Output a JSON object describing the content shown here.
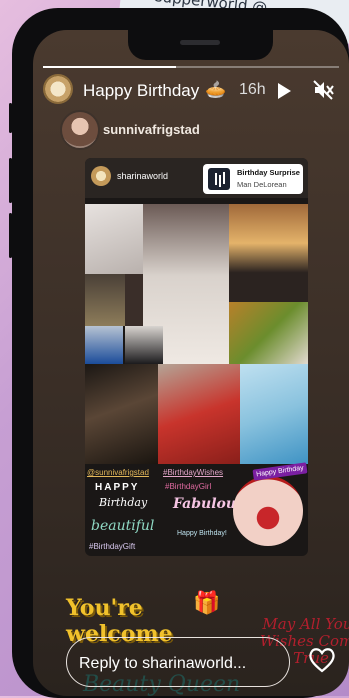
{
  "background_paper": {
    "text": "supperworld @..."
  },
  "story": {
    "header": {
      "title": "Happy Birthday",
      "emoji": "🥧",
      "time": "16h",
      "play_icon": "play-icon",
      "mute_icon": "volume-muted-icon"
    },
    "mention_user": "sunnivafrigstad",
    "reshared_post": {
      "username": "sharinaworld",
      "music": {
        "title": "Birthday Surprise",
        "artist": "Man DeLorean"
      },
      "collage_labels": {
        "tag": "@sunnivafrigstad",
        "hashtag1": "#BirthdayWishes",
        "hashtag2": "#BirthdayGirl",
        "hashtag3": "#BirthdayGift",
        "happy": "HAPPY",
        "birthday": "Birthday",
        "beautiful": "beautiful",
        "fabulous": "Fabulous",
        "happy_birthday_small": "Happy Birthday!",
        "hb_card": "Happy Birthday"
      }
    },
    "stickers": {
      "welcome_line1": "You're",
      "welcome_line2": "welcome",
      "gift_emoji": "🎁",
      "wish": "May All Your Wishes Come True",
      "queen": "Beauty Queen"
    },
    "reply": {
      "placeholder": "Reply to sharinaworld...",
      "heart_icon": "heart-icon",
      "send_icon": "send-icon"
    }
  }
}
